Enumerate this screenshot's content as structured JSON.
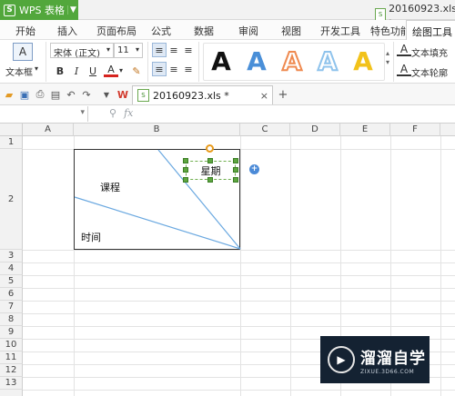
{
  "app": {
    "menu_label": "WPS 表格",
    "logo": "S",
    "doc_title": "20160923.xls ·"
  },
  "menu_tabs": [
    "开始",
    "插入",
    "页面布局",
    "公式",
    "数据",
    "审阅",
    "视图",
    "开发工具",
    "特色功能",
    "绘图工具"
  ],
  "active_tab": "绘图工具",
  "ribbon": {
    "textbox_label": "文本框",
    "font_name": "宋体 (正文)",
    "font_size": "11",
    "bold": "B",
    "italic": "I",
    "underline": "U",
    "font_color": "A",
    "art_text_style": "A",
    "text_fill": "文本填充",
    "text_outline": "文本轮廓"
  },
  "file_tab": {
    "name": "20160923.xls *",
    "close": "×",
    "new_tab": "+"
  },
  "formula_bar": {
    "fx": "fx"
  },
  "columns": [
    "A",
    "B",
    "C",
    "D",
    "E",
    "F"
  ],
  "rows": [
    "1",
    "2",
    "3",
    "4",
    "5",
    "6",
    "7",
    "8",
    "9",
    "10",
    "11",
    "12",
    "13"
  ],
  "cells": {
    "course": "课程",
    "time": "时间",
    "weekday": "星期"
  },
  "watermark": {
    "main": "溜溜自学",
    "sub": "ZIXUE.3D66.COM"
  },
  "colors": {
    "accent_green": "#52a73c",
    "art_styles": [
      "#111111",
      "#4a8fd8",
      "#ef8a50",
      "#8fc3ec",
      "#f2c21a"
    ],
    "diagonal": "#6aa8e0"
  }
}
